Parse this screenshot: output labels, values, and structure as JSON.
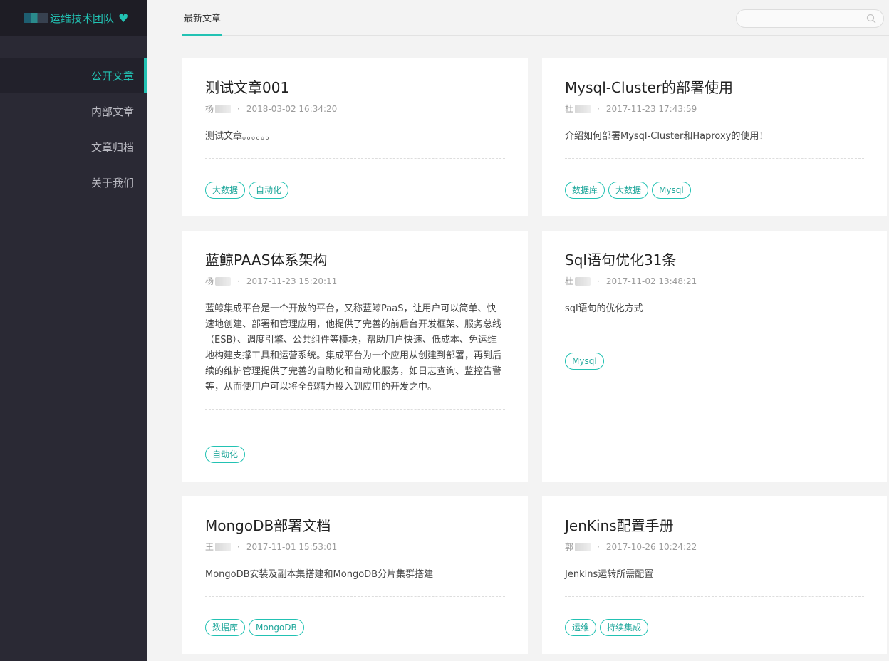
{
  "brand": {
    "name": "运维技术团队",
    "heart": "♥"
  },
  "nav": [
    {
      "label": "公开文章",
      "active": true
    },
    {
      "label": "内部文章"
    },
    {
      "label": "文章归档"
    },
    {
      "label": "关于我们"
    }
  ],
  "topbar": {
    "tab": "最新文章",
    "search_placeholder": ""
  },
  "articles": [
    {
      "title": "测试文章001",
      "author": "杨",
      "date": "2018-03-02 16:34:20",
      "desc": "测试文章。。。。。。",
      "tags": [
        "大数据",
        "自动化"
      ]
    },
    {
      "title": "Mysql-Cluster的部署使用",
      "author": "杜",
      "date": "2017-11-23 17:43:59",
      "desc": "介绍如何部署Mysql-Cluster和Haproxy的使用！",
      "tags": [
        "数据库",
        "大数据",
        "Mysql"
      ]
    },
    {
      "title": "蓝鲸PAAS体系架构",
      "author": "杨",
      "date": "2017-11-23 15:20:11",
      "desc": "蓝鲸集成平台是一个开放的平台，又称蓝鲸PaaS，让用户可以简单、快速地创建、部署和管理应用，他提供了完善的前后台开发框架、服务总线（ESB）、调度引擎、公共组件等模块，帮助用户快速、低成本、免运维地构建支撑工具和运营系统。集成平台为一个应用从创建到部署，再到后续的维护管理提供了完善的自助化和自动化服务，如日志查询、监控告警等，从而使用户可以将全部精力投入到应用的开发之中。",
      "tags": [
        "自动化"
      ]
    },
    {
      "title": "Sql语句优化31条",
      "author": "杜",
      "date": "2017-11-02 13:48:21",
      "desc": "sql语句的优化方式",
      "tags": [
        "Mysql"
      ]
    },
    {
      "title": "MongoDB部署文档",
      "author": "王",
      "date": "2017-11-01 15:53:01",
      "desc": "MongoDB安装及副本集搭建和MongoDB分片集群搭建",
      "tags": [
        "数据库",
        "MongoDB"
      ]
    },
    {
      "title": "JenKins配置手册",
      "author": "郭",
      "date": "2017-10-26 10:24:22",
      "desc": "Jenkins运转所需配置",
      "tags": [
        "运维",
        "持续集成"
      ]
    }
  ]
}
